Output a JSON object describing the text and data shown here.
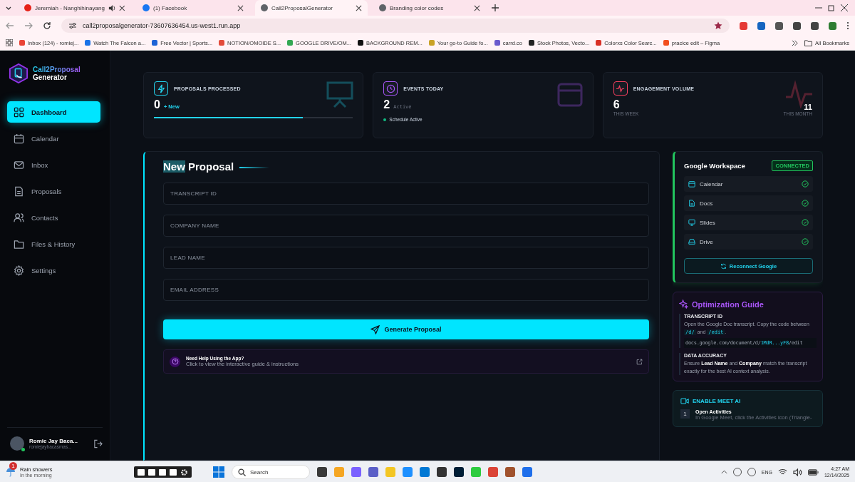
{
  "browser": {
    "tabs": [
      {
        "title": "Jeremiah - Nanghihinayang",
        "selected": false,
        "audio": true,
        "color": "#e62117"
      },
      {
        "title": "(1) Facebook",
        "selected": false,
        "audio": false,
        "color": "#1877f2"
      },
      {
        "title": "Call2ProposalGenerator",
        "selected": true,
        "audio": false,
        "color": "#5f6368"
      },
      {
        "title": "Branding color codes",
        "selected": false,
        "audio": false,
        "color": "#5f6368"
      }
    ],
    "address": "call2proposalgenerator-73607636454.us-west1.run.app",
    "bookmarks": [
      {
        "label": "Inbox (124) - romiej...",
        "color": "#ea4335"
      },
      {
        "label": "Watch The Falcon a...",
        "color": "#1a73e8"
      },
      {
        "label": "Free Vector | Sports...",
        "color": "#1e63d6"
      },
      {
        "label": "NOTION/OMOIDE S...",
        "color": "#e34b3a"
      },
      {
        "label": "GOOGLE DRIVE/OM...",
        "color": "#34a853"
      },
      {
        "label": "BACKGROUND REM...",
        "color": "#111111"
      },
      {
        "label": "Your go-to Guide fo...",
        "color": "#c9a227"
      },
      {
        "label": "carrd.co",
        "color": "#6a5acd"
      },
      {
        "label": "Stock Photos, Vecto...",
        "color": "#222222"
      },
      {
        "label": "Colorxs Color Searc...",
        "color": "#d93025"
      },
      {
        "label": "pracice edit – Figma",
        "color": "#f24e1e"
      }
    ],
    "all_bookmarks": "All Bookmarks"
  },
  "sidebar": {
    "brand_line1": "Call2Proposal",
    "brand_line2": "Generator",
    "items": [
      {
        "label": "Dashboard",
        "selected": true,
        "kind": "grid"
      },
      {
        "label": "Calendar",
        "selected": false,
        "kind": "calendar"
      },
      {
        "label": "Inbox",
        "selected": false,
        "kind": "mail"
      },
      {
        "label": "Proposals",
        "selected": false,
        "kind": "doc"
      },
      {
        "label": "Contacts",
        "selected": false,
        "kind": "users"
      },
      {
        "label": "Files & History",
        "selected": false,
        "kind": "folder"
      },
      {
        "label": "Settings",
        "selected": false,
        "kind": "gear"
      }
    ],
    "user": {
      "name": "Romie Jay Baca...",
      "email": "romiejaybacasmas...",
      "online": true
    }
  },
  "stats": [
    {
      "kind": "progress",
      "label": "PROPOSALS PROCESSED",
      "value": "0",
      "note": "+ New",
      "level": 0.75,
      "color": "#22d3ee"
    },
    {
      "kind": "status",
      "label": "EVENTS TODAY",
      "value": "2",
      "note": "Active",
      "status": "Schedule Active",
      "color": "#a855f7"
    },
    {
      "kind": "split",
      "label": "ENGAGEMENT VOLUME",
      "value": "6",
      "note": "THIS WEEK",
      "value2": "11",
      "note2": "THIS MONTH",
      "color": "#f43f5e"
    }
  ],
  "form": {
    "title_parts": [
      {
        "text": "New",
        "highlighted": true
      },
      {
        "text": "Proposal",
        "highlighted": false
      }
    ],
    "fields": [
      {
        "placeholder": "TRANSCRIPT ID"
      },
      {
        "placeholder": "COMPANY NAME"
      },
      {
        "placeholder": "LEAD NAME"
      },
      {
        "placeholder": "EMAIL ADDRESS"
      }
    ],
    "submit": "Generate Proposal",
    "help": {
      "title": "Need Help Using the App?",
      "subtitle": "Click to view the interactive guide & instructions"
    }
  },
  "workspace": {
    "title": "Google Workspace",
    "badge": "CONNECTED",
    "services": [
      {
        "label": "Calendar",
        "connected": true,
        "kind": "calendar"
      },
      {
        "label": "Docs",
        "connected": true,
        "kind": "doc"
      },
      {
        "label": "Slides",
        "connected": true,
        "kind": "monitor"
      },
      {
        "label": "Drive",
        "connected": true,
        "kind": "drive"
      }
    ],
    "reconnect": "Reconnect Google"
  },
  "guide": {
    "title": "Optimization Guide",
    "sections": [
      {
        "kind": "code",
        "heading": "TRANSCRIPT ID",
        "parts": [
          {
            "text": "Open the Google Doc transcript. Copy the code between ",
            "code": false
          },
          {
            "text": "/d/",
            "code": true
          },
          {
            "text": " and ",
            "code": false
          },
          {
            "text": "/edit",
            "code": true
          },
          {
            "text": ".",
            "code": false
          }
        ],
        "snippet": [
          {
            "text": "docs.google.com/document/d/",
            "code": false
          },
          {
            "text": "1MdR...yF8",
            "code": true
          },
          {
            "text": "/edit",
            "code": false
          }
        ]
      },
      {
        "kind": "text",
        "heading": "DATA ACCURACY",
        "text": "Ensure **Lead Name** and **Company** match the transcript exactly for the best AI context analysis."
      }
    ]
  },
  "meet": {
    "title": "ENABLE MEET AI",
    "steps": [
      {
        "number": "1",
        "title": "Open Activities",
        "text": "In Google Meet, click the Activities icon (Triangle-"
      }
    ]
  },
  "taskbar": {
    "weather": {
      "badge": "1",
      "line1": "Rain showers",
      "line2": "In the morning"
    },
    "search": "Search",
    "language": "ENG",
    "time": "4:27 AM",
    "date": "12/14/2025"
  }
}
